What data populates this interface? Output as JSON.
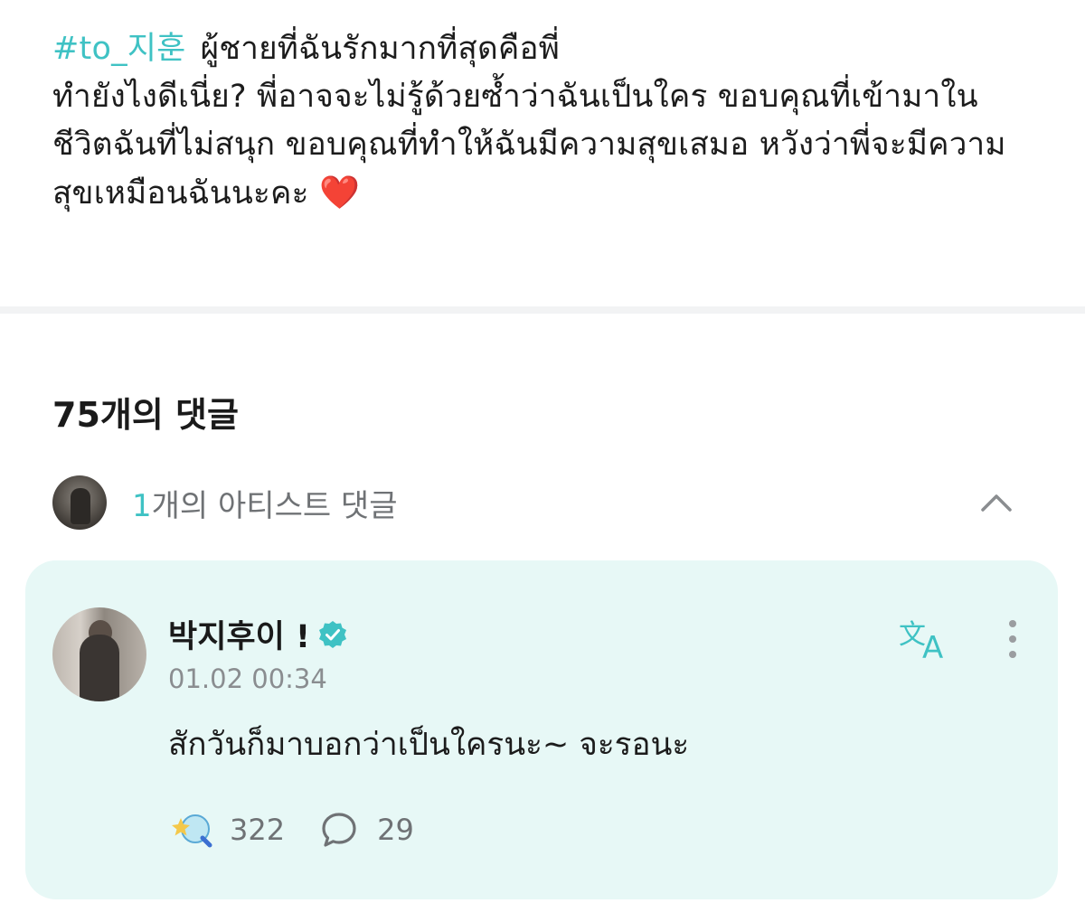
{
  "post": {
    "hashtag": "#to_지훈",
    "title": "ผู้ชายที่ฉันรักมากที่สุดคือพี่",
    "body": "ทำยังไงดีเนี่ย? พี่อาจจะไม่รู้ด้วยซ้ำว่าฉันเป็นใคร ขอบคุณที่เข้ามาในชีวิตฉันที่ไม่สนุก ขอบคุณที่ทำให้ฉันมีความสุขเสมอ หวังว่าพี่จะมีความสุขเหมือนฉันนะคะ",
    "heart": "❤️"
  },
  "comments": {
    "count_label": "75개의 댓글",
    "artist_count": "1",
    "artist_label": "개의 아티스트 댓글"
  },
  "artist_comment": {
    "author": "박지후이 !",
    "timestamp": "01.02 00:34",
    "text": "สักวันก็มาบอกว่าเป็นใครนะ~ จะรอนะ",
    "likes": "322",
    "replies": "29"
  },
  "icons": {
    "verified": "verified-badge-icon",
    "translate": "translate-icon",
    "more": "more-vertical-icon",
    "collapse": "chevron-up-icon",
    "like": "sparkle-like-icon",
    "reply": "speech-bubble-icon"
  },
  "colors": {
    "accent": "#3fc2c4",
    "card_background": "#e7f8f6",
    "muted_text": "#6f7275"
  }
}
